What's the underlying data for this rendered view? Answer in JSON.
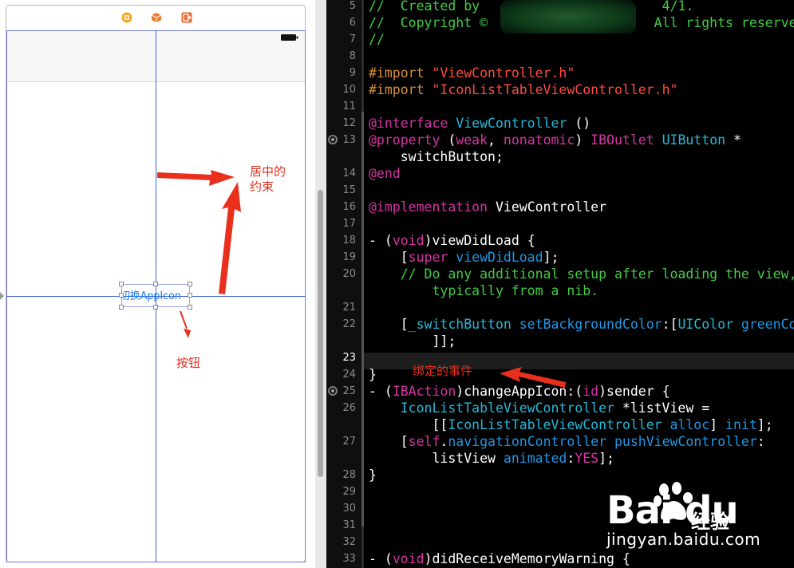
{
  "interface_builder": {
    "dock_icons": [
      "view-controller-icon",
      "first-responder-icon",
      "exit-icon"
    ],
    "button_title": "切换AppIcon",
    "annotations": {
      "center_constraint": "居中的\n约束",
      "button": "按钮"
    }
  },
  "editor": {
    "current_line": 23,
    "binding_annotation": "绑定的事件",
    "lines": [
      {
        "n": "5",
        "segs": [
          [
            "c-com",
            "//  Created by "
          ],
          [
            "c-com",
            "                      "
          ],
          [
            "c-com",
            "4/1."
          ]
        ]
      },
      {
        "n": "6",
        "segs": [
          [
            "c-com",
            "//  Copyright © "
          ],
          [
            "c-com",
            "                    "
          ],
          [
            "c-com",
            "All rights reserved."
          ]
        ]
      },
      {
        "n": "7",
        "segs": [
          [
            "c-com",
            "//"
          ]
        ]
      },
      {
        "n": "8",
        "segs": []
      },
      {
        "n": "9",
        "segs": [
          [
            "c-pre",
            "#import "
          ],
          [
            "c-str",
            "\"ViewController.h\""
          ]
        ]
      },
      {
        "n": "10",
        "segs": [
          [
            "c-pre",
            "#import "
          ],
          [
            "c-str",
            "\"IconListTableViewController.h\""
          ]
        ]
      },
      {
        "n": "11",
        "segs": []
      },
      {
        "n": "12",
        "segs": [
          [
            "c-kw",
            "@interface "
          ],
          [
            "c-cls",
            "ViewController"
          ],
          [
            "",
            " ()"
          ]
        ]
      },
      {
        "n": "13",
        "segs": [
          [
            "c-kw",
            "@property "
          ],
          [
            "",
            "("
          ],
          [
            "c-kw",
            "weak"
          ],
          [
            "",
            ", "
          ],
          [
            "c-kw",
            "nonatomic"
          ],
          [
            "",
            ") "
          ],
          [
            "c-kw",
            "IBOutlet "
          ],
          [
            "c-cls",
            "UIButton"
          ],
          [
            "",
            " *"
          ]
        ],
        "breakpoint": true
      },
      {
        "n": "",
        "segs": [
          [
            "",
            "    switchButton;"
          ]
        ]
      },
      {
        "n": "14",
        "segs": [
          [
            "c-kw",
            "@end"
          ]
        ]
      },
      {
        "n": "15",
        "segs": []
      },
      {
        "n": "16",
        "segs": [
          [
            "c-kw",
            "@implementation "
          ],
          [
            "",
            "ViewController"
          ]
        ]
      },
      {
        "n": "17",
        "segs": []
      },
      {
        "n": "18",
        "segs": [
          [
            "",
            "- ("
          ],
          [
            "c-kw",
            "void"
          ],
          [
            "",
            ")viewDidLoad {"
          ]
        ]
      },
      {
        "n": "19",
        "segs": [
          [
            "",
            "    ["
          ],
          [
            "c-kw",
            "super "
          ],
          [
            "c-fn",
            "viewDidLoad"
          ],
          [
            "",
            "];"
          ]
        ]
      },
      {
        "n": "20",
        "segs": [
          [
            "c-com",
            "    // Do any additional setup after loading the view,"
          ]
        ]
      },
      {
        "n": "",
        "segs": [
          [
            "c-com",
            "        typically from a nib."
          ]
        ]
      },
      {
        "n": "21",
        "segs": []
      },
      {
        "n": "22",
        "segs": [
          [
            "",
            "    ["
          ],
          [
            "c-cls",
            "_switchButton "
          ],
          [
            "c-fn",
            "setBackgroundColor"
          ],
          [
            "",
            ":["
          ],
          [
            "c-cls",
            "UIColor "
          ],
          [
            "c-fn",
            "greenColor"
          ]
        ]
      },
      {
        "n": "",
        "segs": [
          [
            "",
            "        ]];"
          ]
        ]
      },
      {
        "n": "23",
        "segs": []
      },
      {
        "n": "24",
        "segs": [
          [
            "",
            "}"
          ]
        ]
      },
      {
        "n": "25",
        "segs": [
          [
            "",
            "- ("
          ],
          [
            "c-kw",
            "IBAction"
          ],
          [
            "",
            ")changeAppIcon:("
          ],
          [
            "c-kw",
            "id"
          ],
          [
            "",
            ")sender {"
          ]
        ],
        "breakpoint": true
      },
      {
        "n": "26",
        "segs": [
          [
            "c-cls",
            "    IconListTableViewController "
          ],
          [
            "",
            "*listView ="
          ]
        ]
      },
      {
        "n": "",
        "segs": [
          [
            "",
            "        [["
          ],
          [
            "c-cls",
            "IconListTableViewController "
          ],
          [
            "c-fn",
            "alloc"
          ],
          [
            "",
            "] "
          ],
          [
            "c-fn",
            "init"
          ],
          [
            "",
            "];"
          ]
        ]
      },
      {
        "n": "27",
        "segs": [
          [
            "",
            "    ["
          ],
          [
            "c-kw",
            "self"
          ],
          [
            "",
            "."
          ],
          [
            "c-fn",
            "navigationController "
          ],
          [
            "c-fn",
            "pushViewController"
          ],
          [
            "",
            ":"
          ]
        ]
      },
      {
        "n": "",
        "segs": [
          [
            "",
            "        listView "
          ],
          [
            "c-fn",
            "animated"
          ],
          [
            "",
            ":"
          ],
          [
            "c-kw",
            "YES"
          ],
          [
            "",
            "];"
          ]
        ]
      },
      {
        "n": "28",
        "segs": [
          [
            "",
            "}"
          ]
        ]
      },
      {
        "n": "29",
        "segs": []
      },
      {
        "n": "30",
        "segs": []
      },
      {
        "n": "31",
        "segs": []
      },
      {
        "n": "32",
        "segs": []
      },
      {
        "n": "33",
        "segs": [
          [
            "",
            "- ("
          ],
          [
            "c-kw",
            "void"
          ],
          [
            "",
            ")didReceiveMemoryWarning {"
          ]
        ]
      }
    ]
  },
  "watermark": {
    "logo": "Bai du",
    "brand_cn": "经验",
    "url": "jingyan.baidu.com"
  },
  "colors": {
    "comment": "#41cc45",
    "keyword": "#d633a4",
    "string": "#ff4a42",
    "class": "#23b8d8",
    "method": "#1e97e6",
    "annotation": "#e0301e",
    "guide": "#3d63c8"
  }
}
